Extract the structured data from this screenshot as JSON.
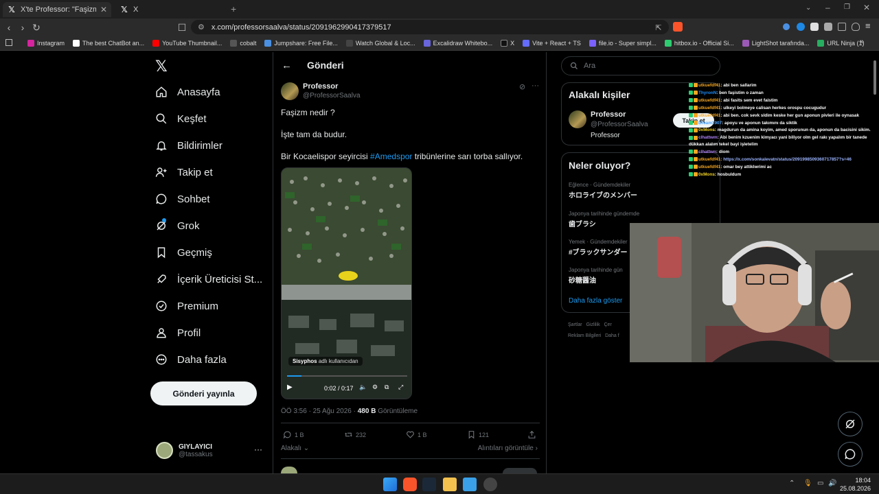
{
  "browser": {
    "tabs": [
      {
        "label": "X'te Professor: \"Faşizm nedir ? İş",
        "active": true
      },
      {
        "label": "X",
        "active": false
      }
    ],
    "url": "x.com/professorsaalva/status/2091962990417379517",
    "bookmarks": [
      {
        "label": "Instagram",
        "color": "#d6249f"
      },
      {
        "label": "The best ChatBot an...",
        "color": "#ffffff"
      },
      {
        "label": "YouTube Thumbnail...",
        "color": "#ff0000"
      },
      {
        "label": "cobalt",
        "color": "#333333"
      },
      {
        "label": "Jumpshare: Free File...",
        "color": "#4a90e2"
      },
      {
        "label": "Watch Global & Loc...",
        "color": "#222222"
      },
      {
        "label": "Excalidraw Whitebo...",
        "color": "#6965db"
      },
      {
        "label": "X",
        "color": "#111111"
      },
      {
        "label": "Vite + React + TS",
        "color": "#646cff"
      },
      {
        "label": "file.io - Super simpl...",
        "color": "#7b61ff"
      },
      {
        "label": "hitbox.io - Official Si...",
        "color": "#2ecc71"
      },
      {
        "label": "LightShot tarafında...",
        "color": "#9b59b6"
      },
      {
        "label": "URL Ninja (1)",
        "color": "#27ae60"
      }
    ]
  },
  "nav": {
    "items": [
      {
        "label": "Anasayfa",
        "icon": "home-icon"
      },
      {
        "label": "Keşfet",
        "icon": "search-icon"
      },
      {
        "label": "Bildirimler",
        "icon": "bell-icon"
      },
      {
        "label": "Takip et",
        "icon": "follow-icon"
      },
      {
        "label": "Sohbet",
        "icon": "chat-icon"
      },
      {
        "label": "Grok",
        "icon": "grok-icon"
      },
      {
        "label": "Geçmiş",
        "icon": "bookmark-icon"
      },
      {
        "label": "İçerik Üreticisi St...",
        "icon": "rocket-icon"
      },
      {
        "label": "Premium",
        "icon": "verified-icon"
      },
      {
        "label": "Profil",
        "icon": "profile-icon"
      },
      {
        "label": "Daha fazla",
        "icon": "more-icon"
      }
    ],
    "post_button": "Gönderi yayınla",
    "account": {
      "name": "GIYLAYICI",
      "handle": "@tassakus"
    }
  },
  "post": {
    "header": "Gönderi",
    "author": "Professor",
    "handle": "@ProfessorSaalva",
    "line1": "Faşizm nedir ?",
    "line2": "İşte tam da budur.",
    "line3_pre": "Bir Kocaelispor seyircisi ",
    "line3_tag": "#Amedspor",
    "line3_post": " tribünlerine sarı torba sallıyor.",
    "video": {
      "credit_user": "Sisyphos",
      "credit_suffix": "adlı kullanıcıdan",
      "time": "0:02 / 0:17",
      "progress": 0.12
    },
    "meta_time": "ÖÖ 3:56 · 25 Ağu 2026 · ",
    "views": "480 B",
    "views_label": "Görüntüleme",
    "replies": "1 B",
    "reposts": "232",
    "likes": "1 B",
    "bookmarks": "121",
    "relevance": "Alakalı",
    "quotes": "Alıntıları görüntüle"
  },
  "right": {
    "search_placeholder": "Ara",
    "related_title": "Alakalı kişiler",
    "related": {
      "name": "Professor",
      "handle": "@ProfessorSaalva",
      "bio": "Professor",
      "follow": "Takip et"
    },
    "trends_title": "Neler oluyor?",
    "trends": [
      {
        "meta": "Eğlence · Gündemdekiler",
        "name": "ホロライブのメンバー"
      },
      {
        "meta": "Japonya tarihinde gündemde",
        "name": "歯ブラシ"
      },
      {
        "meta": "Yemek · Gündemdekiler",
        "name": "#ブラックサンダー"
      },
      {
        "meta": "Japonya tarihinde gün",
        "name": "砂糖醤油"
      }
    ],
    "more": "Daha fazla göster",
    "footer1": "Şartlar   Gizlilik   Çer",
    "footer2": "Reklam Bilgileri   Daha f"
  },
  "chat": [
    {
      "user": "utkuefdf41",
      "color": "#f5a623",
      "msg": ": abi ben sallarim"
    },
    {
      "user": "ThyronN",
      "color": "#1e90ff",
      "msg": ": ben faşistim o zaman"
    },
    {
      "user": "utkuefdf41",
      "color": "#f5a623",
      "msg": ": abi fasits sem evet faistim"
    },
    {
      "user": "utkuefdf41",
      "color": "#f5a623",
      "msg": ": ulkeyi bolmeye calisan herkes orospu cocugudur"
    },
    {
      "user": "utkuefdf41",
      "color": "#f5a623",
      "msg": ": abi ben. cok sevk sldim keske her gun aponun pivleri ile oynasak"
    },
    {
      "user": "Dream1907",
      "color": "#4aa3ff",
      "msg": ": apoyu ve aponun takımını da siktik"
    },
    {
      "user": "0xMons",
      "color": "#f5d623",
      "msg": ": magdurun da amina koyim, amed sporunun da, aponun da bacisini sikim."
    },
    {
      "user": "clhattwm",
      "color": "#b084f5",
      "msg": ": Abi benim kzuenim kimyacı yani biliyor olm gel rakı yapalım bir tanede dükkan alalım tekel bayi işletelim"
    },
    {
      "user": "clhattwn",
      "color": "#b084f5",
      "msg": ": diom"
    },
    {
      "user": "utkuefdf41",
      "color": "#f5a623",
      "msg": ": https://x.com/sonkalevatn/status/2091998509360717857?s=46",
      "link": true
    },
    {
      "user": "utkuefdf41",
      "color": "#f5a623",
      "msg": ": omar bey attiklwrimi ac"
    },
    {
      "user": "0xMons",
      "color": "#f5d623",
      "msg": ": hosbuldum"
    }
  ],
  "taskbar": {
    "time": "18:04",
    "date": "25.08.2026"
  }
}
